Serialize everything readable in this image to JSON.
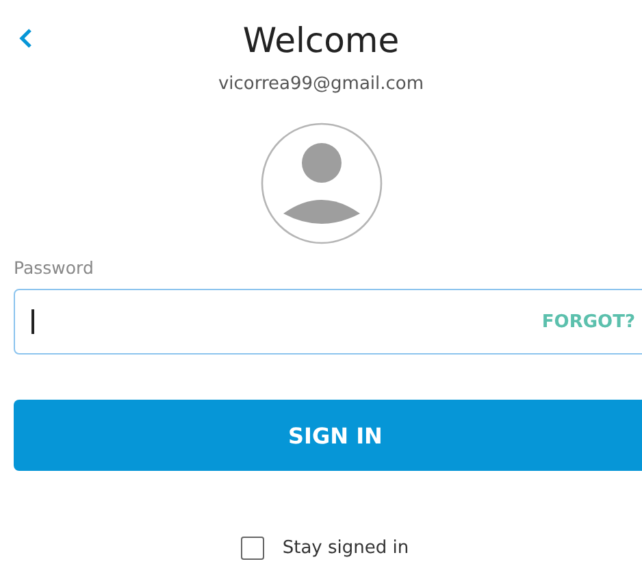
{
  "title": "Welcome",
  "email": "vicorrea99@gmail.com",
  "password": {
    "label": "Password",
    "focused": true,
    "link": "FORGOT?"
  },
  "sign_in_button": "SIGN IN",
  "stay_signed_in": {
    "label": "Stay signed in",
    "checked": false
  }
}
